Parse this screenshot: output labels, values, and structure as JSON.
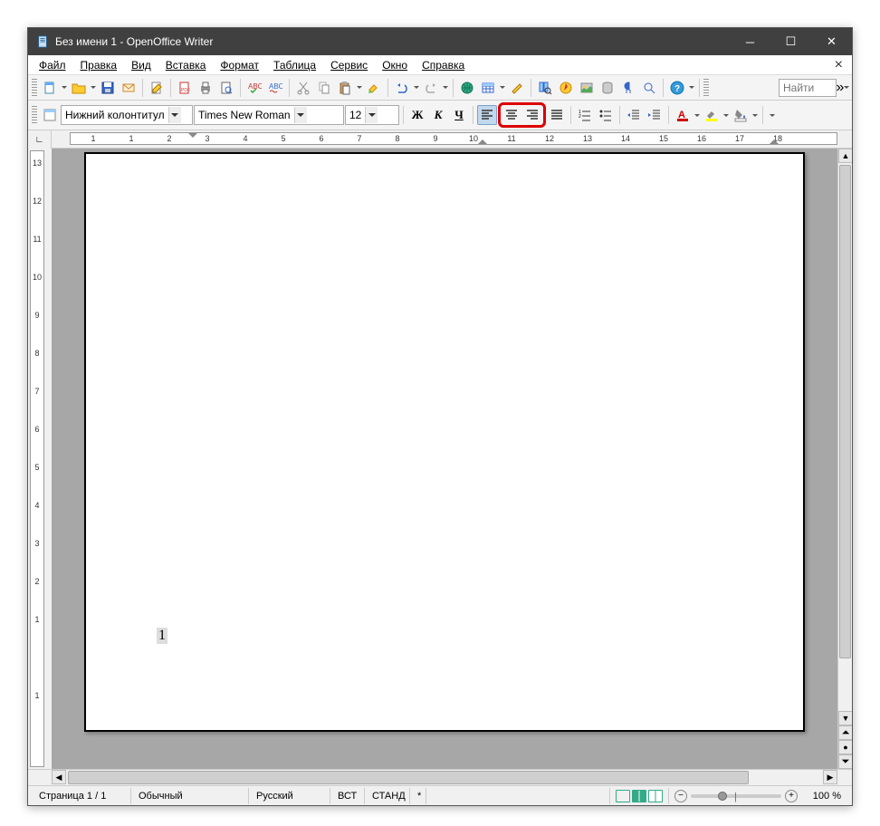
{
  "window": {
    "title": "Без имени 1 - OpenOffice Writer"
  },
  "menu": {
    "file": "Файл",
    "edit": "Правка",
    "view": "Вид",
    "insert": "Вставка",
    "format": "Формат",
    "table": "Таблица",
    "tools": "Сервис",
    "window": "Окно",
    "help": "Справка"
  },
  "toolbar1": {
    "find_placeholder": "Найти"
  },
  "toolbar2": {
    "style": "Нижний колонтитул",
    "font": "Times New Roman",
    "size": "12",
    "bold": "Ж",
    "italic": "К",
    "underline": "Ч"
  },
  "ruler": {
    "h": [
      "1",
      "1",
      "2",
      "3",
      "4",
      "5",
      "6",
      "7",
      "8",
      "9",
      "10",
      "11",
      "12",
      "13",
      "14",
      "15",
      "16",
      "17",
      "18"
    ],
    "v": [
      "13",
      "12",
      "11",
      "10",
      "9",
      "8",
      "7",
      "6",
      "5",
      "4",
      "3",
      "2",
      "1",
      "",
      "1"
    ]
  },
  "page": {
    "footer_number": "1"
  },
  "status": {
    "page": "Страница 1 / 1",
    "style": "Обычный",
    "lang": "Русский",
    "insert": "ВСТ",
    "sel": "СТАНД",
    "mod": "*",
    "zoom": "100 %"
  }
}
